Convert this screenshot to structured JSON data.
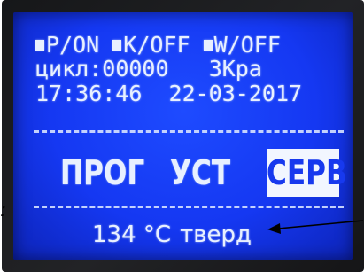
{
  "status": {
    "p_mode": "P/ON",
    "k_mode": "K/OFF",
    "w_mode": "W/OFF"
  },
  "cycle": {
    "label": "цикл:",
    "counter": "00000",
    "pressure": "3Кра"
  },
  "clock": {
    "time": "17:36:46",
    "date": "22-03-2017"
  },
  "menu": {
    "prog": "ПРОГ",
    "ust": "УСТ",
    "serv": "СЕРВ",
    "selected": "serv"
  },
  "bottom": {
    "temperature": "134",
    "unit": "°С",
    "state": "тверд"
  },
  "edge_mark": ":",
  "colors": {
    "screen": "#1538f2",
    "text": "#e8f0ff",
    "bezel": "#1b1c1f"
  }
}
